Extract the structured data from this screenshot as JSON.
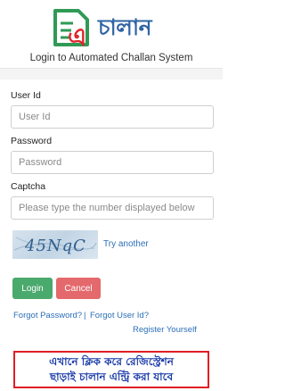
{
  "header": {
    "logo_letter": "এ",
    "logo_text": "চালান",
    "subtitle": "Login to Automated Challan System"
  },
  "form": {
    "user_id_label": "User Id",
    "user_id_placeholder": "User Id",
    "password_label": "Password",
    "password_placeholder": "Password",
    "captcha_label": "Captcha",
    "captcha_placeholder": "Please type the number displayed below",
    "captcha_code": "45NqC",
    "try_another": "Try another",
    "login_button": "Login",
    "cancel_button": "Cancel",
    "forgot_password": "Forgot Password?",
    "separator": "|",
    "forgot_user_id": "Forgot User Id?",
    "register": "Register Yourself"
  },
  "notice": {
    "line1": "এখানে ক্লিক করে রেজিস্ট্রেশন",
    "line2": "ছাড়াই চালান এন্ট্রি করা যাবে"
  },
  "colors": {
    "brand_green": "#2f9a55",
    "brand_blue": "#2f64a4",
    "login_green": "#4aa96c",
    "cancel_red": "#e4696c",
    "link_blue": "#2c6fb7",
    "notice_border": "#e01e25"
  }
}
